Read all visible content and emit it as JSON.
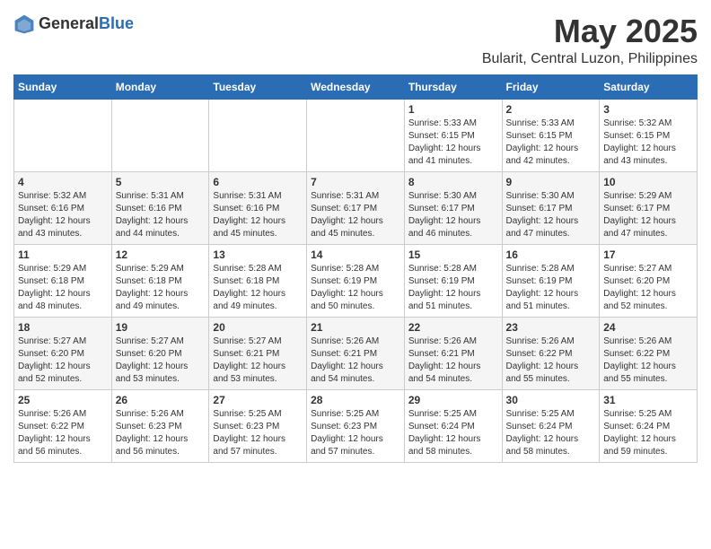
{
  "header": {
    "logo_general": "General",
    "logo_blue": "Blue",
    "month_title": "May 2025",
    "location": "Bularit, Central Luzon, Philippines"
  },
  "days_of_week": [
    "Sunday",
    "Monday",
    "Tuesday",
    "Wednesday",
    "Thursday",
    "Friday",
    "Saturday"
  ],
  "weeks": [
    [
      {
        "day": "",
        "sunrise": "",
        "sunset": "",
        "daylight": ""
      },
      {
        "day": "",
        "sunrise": "",
        "sunset": "",
        "daylight": ""
      },
      {
        "day": "",
        "sunrise": "",
        "sunset": "",
        "daylight": ""
      },
      {
        "day": "",
        "sunrise": "",
        "sunset": "",
        "daylight": ""
      },
      {
        "day": "1",
        "sunrise": "Sunrise: 5:33 AM",
        "sunset": "Sunset: 6:15 PM",
        "daylight": "Daylight: 12 hours and 41 minutes."
      },
      {
        "day": "2",
        "sunrise": "Sunrise: 5:33 AM",
        "sunset": "Sunset: 6:15 PM",
        "daylight": "Daylight: 12 hours and 42 minutes."
      },
      {
        "day": "3",
        "sunrise": "Sunrise: 5:32 AM",
        "sunset": "Sunset: 6:15 PM",
        "daylight": "Daylight: 12 hours and 43 minutes."
      }
    ],
    [
      {
        "day": "4",
        "sunrise": "Sunrise: 5:32 AM",
        "sunset": "Sunset: 6:16 PM",
        "daylight": "Daylight: 12 hours and 43 minutes."
      },
      {
        "day": "5",
        "sunrise": "Sunrise: 5:31 AM",
        "sunset": "Sunset: 6:16 PM",
        "daylight": "Daylight: 12 hours and 44 minutes."
      },
      {
        "day": "6",
        "sunrise": "Sunrise: 5:31 AM",
        "sunset": "Sunset: 6:16 PM",
        "daylight": "Daylight: 12 hours and 45 minutes."
      },
      {
        "day": "7",
        "sunrise": "Sunrise: 5:31 AM",
        "sunset": "Sunset: 6:17 PM",
        "daylight": "Daylight: 12 hours and 45 minutes."
      },
      {
        "day": "8",
        "sunrise": "Sunrise: 5:30 AM",
        "sunset": "Sunset: 6:17 PM",
        "daylight": "Daylight: 12 hours and 46 minutes."
      },
      {
        "day": "9",
        "sunrise": "Sunrise: 5:30 AM",
        "sunset": "Sunset: 6:17 PM",
        "daylight": "Daylight: 12 hours and 47 minutes."
      },
      {
        "day": "10",
        "sunrise": "Sunrise: 5:29 AM",
        "sunset": "Sunset: 6:17 PM",
        "daylight": "Daylight: 12 hours and 47 minutes."
      }
    ],
    [
      {
        "day": "11",
        "sunrise": "Sunrise: 5:29 AM",
        "sunset": "Sunset: 6:18 PM",
        "daylight": "Daylight: 12 hours and 48 minutes."
      },
      {
        "day": "12",
        "sunrise": "Sunrise: 5:29 AM",
        "sunset": "Sunset: 6:18 PM",
        "daylight": "Daylight: 12 hours and 49 minutes."
      },
      {
        "day": "13",
        "sunrise": "Sunrise: 5:28 AM",
        "sunset": "Sunset: 6:18 PM",
        "daylight": "Daylight: 12 hours and 49 minutes."
      },
      {
        "day": "14",
        "sunrise": "Sunrise: 5:28 AM",
        "sunset": "Sunset: 6:19 PM",
        "daylight": "Daylight: 12 hours and 50 minutes."
      },
      {
        "day": "15",
        "sunrise": "Sunrise: 5:28 AM",
        "sunset": "Sunset: 6:19 PM",
        "daylight": "Daylight: 12 hours and 51 minutes."
      },
      {
        "day": "16",
        "sunrise": "Sunrise: 5:28 AM",
        "sunset": "Sunset: 6:19 PM",
        "daylight": "Daylight: 12 hours and 51 minutes."
      },
      {
        "day": "17",
        "sunrise": "Sunrise: 5:27 AM",
        "sunset": "Sunset: 6:20 PM",
        "daylight": "Daylight: 12 hours and 52 minutes."
      }
    ],
    [
      {
        "day": "18",
        "sunrise": "Sunrise: 5:27 AM",
        "sunset": "Sunset: 6:20 PM",
        "daylight": "Daylight: 12 hours and 52 minutes."
      },
      {
        "day": "19",
        "sunrise": "Sunrise: 5:27 AM",
        "sunset": "Sunset: 6:20 PM",
        "daylight": "Daylight: 12 hours and 53 minutes."
      },
      {
        "day": "20",
        "sunrise": "Sunrise: 5:27 AM",
        "sunset": "Sunset: 6:21 PM",
        "daylight": "Daylight: 12 hours and 53 minutes."
      },
      {
        "day": "21",
        "sunrise": "Sunrise: 5:26 AM",
        "sunset": "Sunset: 6:21 PM",
        "daylight": "Daylight: 12 hours and 54 minutes."
      },
      {
        "day": "22",
        "sunrise": "Sunrise: 5:26 AM",
        "sunset": "Sunset: 6:21 PM",
        "daylight": "Daylight: 12 hours and 54 minutes."
      },
      {
        "day": "23",
        "sunrise": "Sunrise: 5:26 AM",
        "sunset": "Sunset: 6:22 PM",
        "daylight": "Daylight: 12 hours and 55 minutes."
      },
      {
        "day": "24",
        "sunrise": "Sunrise: 5:26 AM",
        "sunset": "Sunset: 6:22 PM",
        "daylight": "Daylight: 12 hours and 55 minutes."
      }
    ],
    [
      {
        "day": "25",
        "sunrise": "Sunrise: 5:26 AM",
        "sunset": "Sunset: 6:22 PM",
        "daylight": "Daylight: 12 hours and 56 minutes."
      },
      {
        "day": "26",
        "sunrise": "Sunrise: 5:26 AM",
        "sunset": "Sunset: 6:23 PM",
        "daylight": "Daylight: 12 hours and 56 minutes."
      },
      {
        "day": "27",
        "sunrise": "Sunrise: 5:25 AM",
        "sunset": "Sunset: 6:23 PM",
        "daylight": "Daylight: 12 hours and 57 minutes."
      },
      {
        "day": "28",
        "sunrise": "Sunrise: 5:25 AM",
        "sunset": "Sunset: 6:23 PM",
        "daylight": "Daylight: 12 hours and 57 minutes."
      },
      {
        "day": "29",
        "sunrise": "Sunrise: 5:25 AM",
        "sunset": "Sunset: 6:24 PM",
        "daylight": "Daylight: 12 hours and 58 minutes."
      },
      {
        "day": "30",
        "sunrise": "Sunrise: 5:25 AM",
        "sunset": "Sunset: 6:24 PM",
        "daylight": "Daylight: 12 hours and 58 minutes."
      },
      {
        "day": "31",
        "sunrise": "Sunrise: 5:25 AM",
        "sunset": "Sunset: 6:24 PM",
        "daylight": "Daylight: 12 hours and 59 minutes."
      }
    ]
  ]
}
